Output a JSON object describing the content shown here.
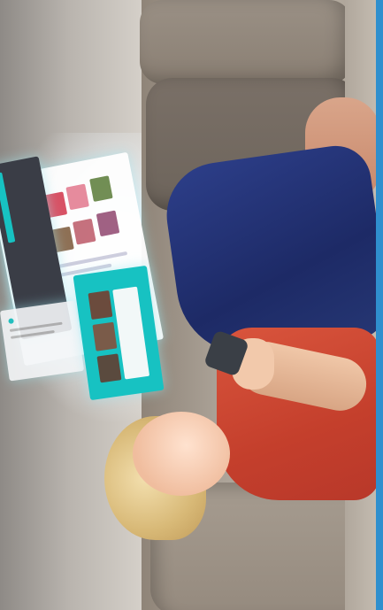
{
  "scene": {
    "description_free": true,
    "colors": {
      "accent_teal": "#17c2c2",
      "frame_blue": "#2f8fce",
      "jeans": "#1d2a66",
      "shirt": "#c43f2c",
      "sofa": "#a9a095"
    }
  },
  "floating_screens": {
    "teal_card": {
      "title": "",
      "tiles": [
        "#6b4b3d",
        "#7a5b49",
        "#5a4a3e"
      ]
    },
    "main_card": {
      "tiles": [
        "#d94b5f",
        "#e7879a",
        "#6c8a4d",
        "#8a6a4e",
        "#c46b78",
        "#9c5a7e"
      ]
    }
  }
}
